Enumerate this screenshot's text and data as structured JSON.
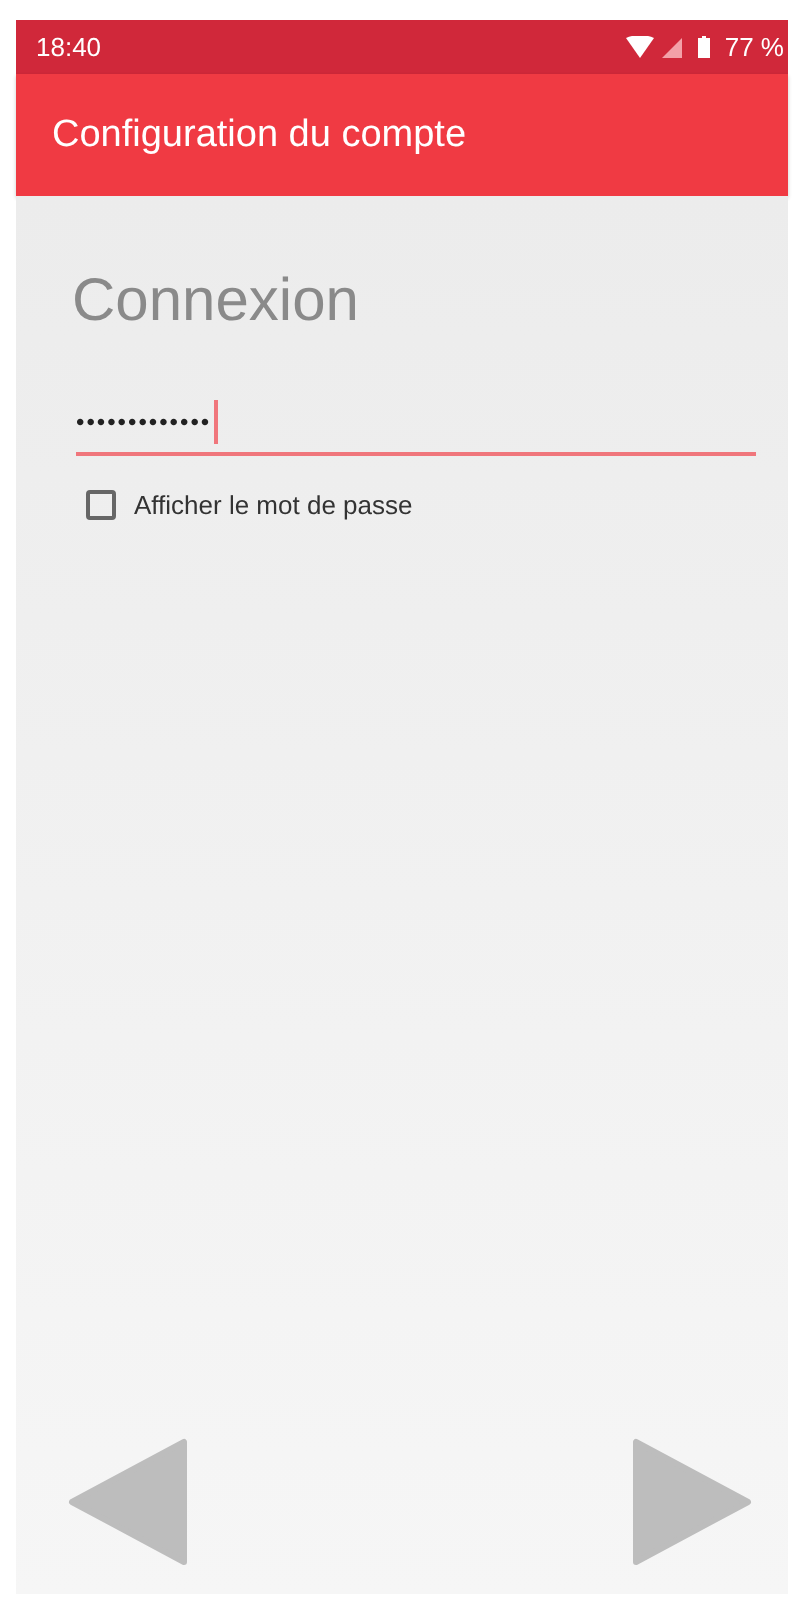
{
  "status_bar": {
    "time": "18:40",
    "battery": "77 %"
  },
  "app_bar": {
    "title": "Configuration du compte"
  },
  "heading": "Connexion",
  "password_field": {
    "value": "•••••••••••••"
  },
  "show_password": {
    "label": "Afficher le mot de passe",
    "checked": false
  }
}
